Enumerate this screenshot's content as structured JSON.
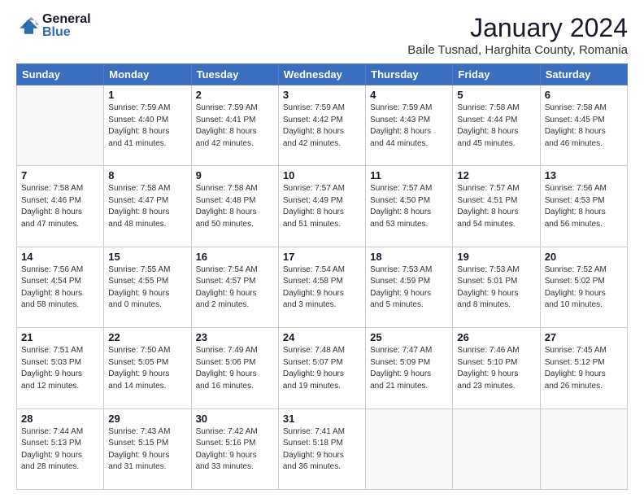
{
  "logo": {
    "general": "General",
    "blue": "Blue"
  },
  "header": {
    "month": "January 2024",
    "location": "Baile Tusnad, Harghita County, Romania"
  },
  "weekdays": [
    "Sunday",
    "Monday",
    "Tuesday",
    "Wednesday",
    "Thursday",
    "Friday",
    "Saturday"
  ],
  "weeks": [
    [
      {
        "day": "",
        "info": ""
      },
      {
        "day": "1",
        "info": "Sunrise: 7:59 AM\nSunset: 4:40 PM\nDaylight: 8 hours\nand 41 minutes."
      },
      {
        "day": "2",
        "info": "Sunrise: 7:59 AM\nSunset: 4:41 PM\nDaylight: 8 hours\nand 42 minutes."
      },
      {
        "day": "3",
        "info": "Sunrise: 7:59 AM\nSunset: 4:42 PM\nDaylight: 8 hours\nand 42 minutes."
      },
      {
        "day": "4",
        "info": "Sunrise: 7:59 AM\nSunset: 4:43 PM\nDaylight: 8 hours\nand 44 minutes."
      },
      {
        "day": "5",
        "info": "Sunrise: 7:58 AM\nSunset: 4:44 PM\nDaylight: 8 hours\nand 45 minutes."
      },
      {
        "day": "6",
        "info": "Sunrise: 7:58 AM\nSunset: 4:45 PM\nDaylight: 8 hours\nand 46 minutes."
      }
    ],
    [
      {
        "day": "7",
        "info": "Sunrise: 7:58 AM\nSunset: 4:46 PM\nDaylight: 8 hours\nand 47 minutes."
      },
      {
        "day": "8",
        "info": "Sunrise: 7:58 AM\nSunset: 4:47 PM\nDaylight: 8 hours\nand 48 minutes."
      },
      {
        "day": "9",
        "info": "Sunrise: 7:58 AM\nSunset: 4:48 PM\nDaylight: 8 hours\nand 50 minutes."
      },
      {
        "day": "10",
        "info": "Sunrise: 7:57 AM\nSunset: 4:49 PM\nDaylight: 8 hours\nand 51 minutes."
      },
      {
        "day": "11",
        "info": "Sunrise: 7:57 AM\nSunset: 4:50 PM\nDaylight: 8 hours\nand 53 minutes."
      },
      {
        "day": "12",
        "info": "Sunrise: 7:57 AM\nSunset: 4:51 PM\nDaylight: 8 hours\nand 54 minutes."
      },
      {
        "day": "13",
        "info": "Sunrise: 7:56 AM\nSunset: 4:53 PM\nDaylight: 8 hours\nand 56 minutes."
      }
    ],
    [
      {
        "day": "14",
        "info": "Sunrise: 7:56 AM\nSunset: 4:54 PM\nDaylight: 8 hours\nand 58 minutes."
      },
      {
        "day": "15",
        "info": "Sunrise: 7:55 AM\nSunset: 4:55 PM\nDaylight: 9 hours\nand 0 minutes."
      },
      {
        "day": "16",
        "info": "Sunrise: 7:54 AM\nSunset: 4:57 PM\nDaylight: 9 hours\nand 2 minutes."
      },
      {
        "day": "17",
        "info": "Sunrise: 7:54 AM\nSunset: 4:58 PM\nDaylight: 9 hours\nand 3 minutes."
      },
      {
        "day": "18",
        "info": "Sunrise: 7:53 AM\nSunset: 4:59 PM\nDaylight: 9 hours\nand 5 minutes."
      },
      {
        "day": "19",
        "info": "Sunrise: 7:53 AM\nSunset: 5:01 PM\nDaylight: 9 hours\nand 8 minutes."
      },
      {
        "day": "20",
        "info": "Sunrise: 7:52 AM\nSunset: 5:02 PM\nDaylight: 9 hours\nand 10 minutes."
      }
    ],
    [
      {
        "day": "21",
        "info": "Sunrise: 7:51 AM\nSunset: 5:03 PM\nDaylight: 9 hours\nand 12 minutes."
      },
      {
        "day": "22",
        "info": "Sunrise: 7:50 AM\nSunset: 5:05 PM\nDaylight: 9 hours\nand 14 minutes."
      },
      {
        "day": "23",
        "info": "Sunrise: 7:49 AM\nSunset: 5:06 PM\nDaylight: 9 hours\nand 16 minutes."
      },
      {
        "day": "24",
        "info": "Sunrise: 7:48 AM\nSunset: 5:07 PM\nDaylight: 9 hours\nand 19 minutes."
      },
      {
        "day": "25",
        "info": "Sunrise: 7:47 AM\nSunset: 5:09 PM\nDaylight: 9 hours\nand 21 minutes."
      },
      {
        "day": "26",
        "info": "Sunrise: 7:46 AM\nSunset: 5:10 PM\nDaylight: 9 hours\nand 23 minutes."
      },
      {
        "day": "27",
        "info": "Sunrise: 7:45 AM\nSunset: 5:12 PM\nDaylight: 9 hours\nand 26 minutes."
      }
    ],
    [
      {
        "day": "28",
        "info": "Sunrise: 7:44 AM\nSunset: 5:13 PM\nDaylight: 9 hours\nand 28 minutes."
      },
      {
        "day": "29",
        "info": "Sunrise: 7:43 AM\nSunset: 5:15 PM\nDaylight: 9 hours\nand 31 minutes."
      },
      {
        "day": "30",
        "info": "Sunrise: 7:42 AM\nSunset: 5:16 PM\nDaylight: 9 hours\nand 33 minutes."
      },
      {
        "day": "31",
        "info": "Sunrise: 7:41 AM\nSunset: 5:18 PM\nDaylight: 9 hours\nand 36 minutes."
      },
      {
        "day": "",
        "info": ""
      },
      {
        "day": "",
        "info": ""
      },
      {
        "day": "",
        "info": ""
      }
    ]
  ]
}
